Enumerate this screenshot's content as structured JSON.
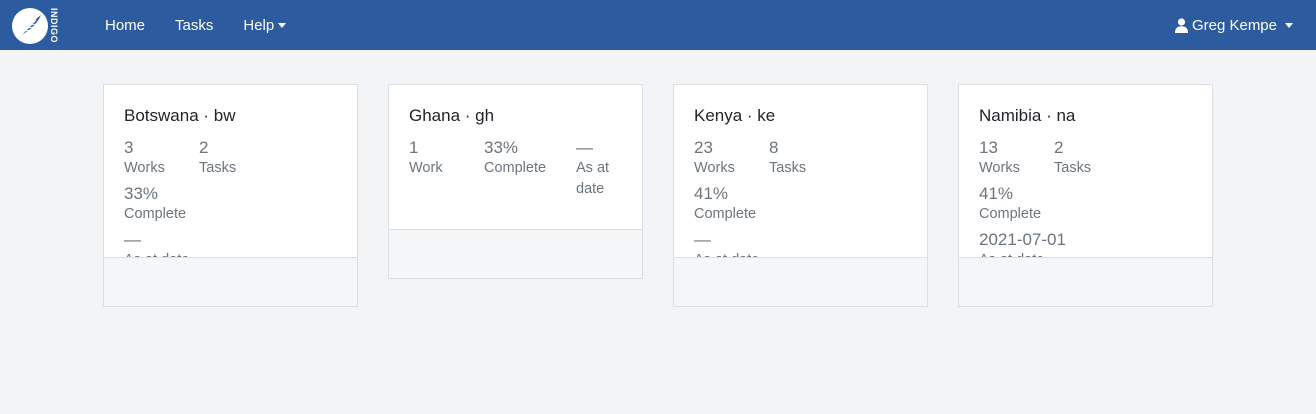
{
  "nav": {
    "logo_text": "INDIGO",
    "home": "Home",
    "tasks": "Tasks",
    "help": "Help",
    "user": "Greg Kempe"
  },
  "cards": [
    {
      "title": "Botswana · bw",
      "works_value": "3",
      "works_label": "Works",
      "tasks_value": "2",
      "tasks_label": "Tasks",
      "complete_value": "33%",
      "complete_label": "Complete",
      "date_value": "—",
      "date_label": "As at date"
    },
    {
      "title": "Ghana · gh",
      "works_value": "1",
      "works_label": "Work",
      "complete_value": "33%",
      "complete_label": "Complete",
      "date_value": "—",
      "date_label": "As at date"
    },
    {
      "title": "Kenya · ke",
      "works_value": "23",
      "works_label": "Works",
      "tasks_value": "8",
      "tasks_label": "Tasks",
      "complete_value": "41%",
      "complete_label": "Complete",
      "date_value": "—",
      "date_label": "As at date"
    },
    {
      "title": "Namibia · na",
      "works_value": "13",
      "works_label": "Works",
      "tasks_value": "2",
      "tasks_label": "Tasks",
      "complete_value": "41%",
      "complete_label": "Complete",
      "date_value": "2021-07-01",
      "date_label": "As at date"
    }
  ]
}
